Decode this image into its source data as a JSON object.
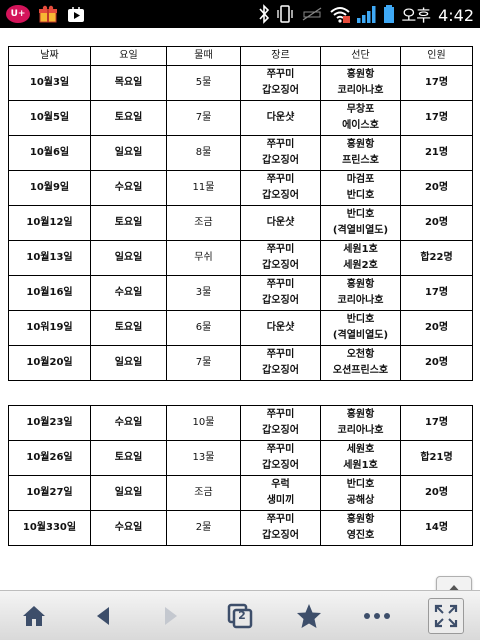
{
  "status_bar": {
    "carrier_badge": "U+",
    "time_ampm": "오후",
    "time": "4:42"
  },
  "table": {
    "headers": [
      "날짜",
      "요일",
      "물때",
      "장르",
      "선단",
      "인원"
    ],
    "rows1": [
      {
        "date": "10월3일",
        "day": "목요일",
        "tide": "5물",
        "genre": [
          "쭈꾸미",
          "갑오징어"
        ],
        "fleet": [
          "홍원항",
          "코리아나호"
        ],
        "people": "17명"
      },
      {
        "date": "10월5일",
        "day": "토요일",
        "tide": "7물",
        "genre": [
          "다운샷"
        ],
        "fleet": [
          "무창포",
          "에이스호"
        ],
        "people": "17명"
      },
      {
        "date": "10월6일",
        "day": "일요일",
        "tide": "8물",
        "genre": [
          "쭈꾸미",
          "갑오징어"
        ],
        "fleet": [
          "홍원항",
          "프린스호"
        ],
        "people": "21명"
      },
      {
        "date": "10월9일",
        "day": "수요일",
        "tide": "11물",
        "genre": [
          "쭈꾸미",
          "갑오징어"
        ],
        "fleet": [
          "마검포",
          "반디호"
        ],
        "people": "20명"
      },
      {
        "date": "10월12일",
        "day": "토요일",
        "tide": "조금",
        "genre": [
          "다운샷"
        ],
        "fleet": [
          "반디호",
          "(격열비열도)"
        ],
        "people": "20명"
      },
      {
        "date": "10월13일",
        "day": "일요일",
        "tide": "무쉬",
        "genre": [
          "쭈꾸미",
          "갑오징어"
        ],
        "fleet": [
          "세원1호",
          "세원2호"
        ],
        "people": "합22명"
      },
      {
        "date": "10월16일",
        "day": "수요일",
        "tide": "3물",
        "genre": [
          "쭈꾸미",
          "갑오징어"
        ],
        "fleet": [
          "홍원항",
          "코리아나호"
        ],
        "people": "17명"
      },
      {
        "date": "10워19일",
        "day": "토요일",
        "tide": "6물",
        "genre": [
          "다운샷"
        ],
        "fleet": [
          "반디호",
          "(격열비열도)"
        ],
        "people": "20명"
      },
      {
        "date": "10월20일",
        "day": "일요일",
        "tide": "7물",
        "genre": [
          "쭈꾸미",
          "갑오징어"
        ],
        "fleet": [
          "오천항",
          "오션프린스호"
        ],
        "people": "20명"
      }
    ],
    "rows2": [
      {
        "date": "10월23일",
        "day": "수요일",
        "tide": "10물",
        "genre": [
          "쭈꾸미",
          "갑오징어"
        ],
        "fleet": [
          "홍원항",
          "코리아나호"
        ],
        "people": "17명"
      },
      {
        "date": "10월26일",
        "day": "토요일",
        "tide": "13물",
        "genre": [
          "쭈꾸미",
          "갑오징어"
        ],
        "fleet": [
          "세원호",
          "세원1호"
        ],
        "people": "합21명"
      },
      {
        "date": "10월27일",
        "day": "일요일",
        "tide": "조금",
        "genre": [
          "우럭",
          "생미끼"
        ],
        "fleet": [
          "반디호",
          "공해상"
        ],
        "people": "20명"
      },
      {
        "date": "10월330일",
        "day": "수요일",
        "tide": "2물",
        "genre": [
          "쭈꾸미",
          "갑오징어"
        ],
        "fleet": [
          "홍원항",
          "영진호"
        ],
        "people": "14명"
      }
    ]
  },
  "toolbar": {
    "tab_count": "2"
  },
  "colors": {
    "status_bg": "#000000",
    "signal_blue": "#3fa9f5",
    "toolbar_icon": "#3d4e6a",
    "uplus_magenta": "#d4145a"
  }
}
